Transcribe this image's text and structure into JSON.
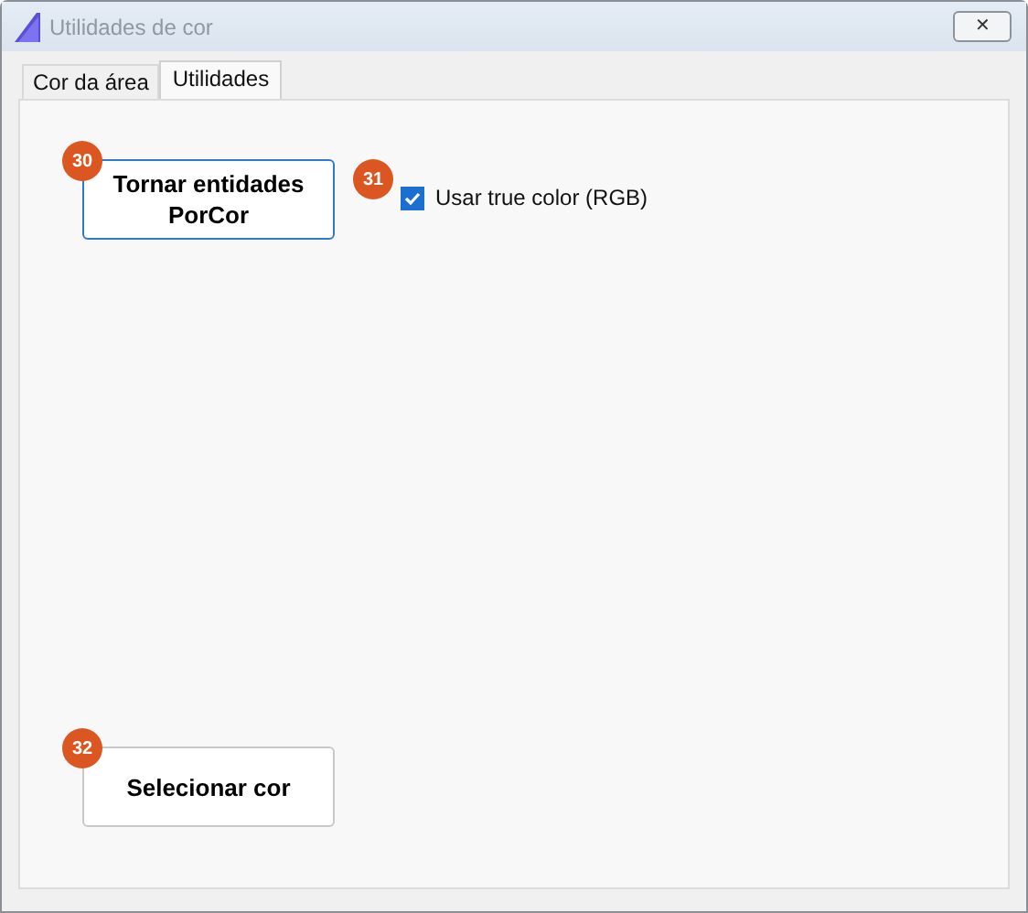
{
  "window": {
    "title": "Utilidades de cor",
    "close": "✕"
  },
  "tabs": [
    {
      "label": "Cor da área",
      "selected": false
    },
    {
      "label": "Utilidades",
      "selected": true
    }
  ],
  "make_bycolor_button": {
    "label": "Tornar entidades PorCor",
    "focused": true,
    "badge": "30"
  },
  "true_color_checkbox": {
    "label": "Usar true color (RGB)",
    "checked": true,
    "badge": "31"
  },
  "select_color_button": {
    "label": "Selecionar cor",
    "focused": false,
    "badge": "32"
  }
}
